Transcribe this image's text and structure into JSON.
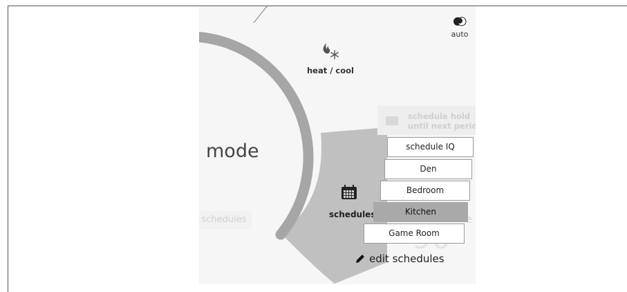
{
  "mode_panel": {
    "title": "mode",
    "ghost_schedules_label": "schedules"
  },
  "modes": {
    "heat_cool": {
      "label": "heat / cool",
      "icon": "flame-snowflake-icon"
    },
    "auto": {
      "label": "auto",
      "icon": "half-moon-icon"
    }
  },
  "schedule_hold": {
    "line1": "schedule hold",
    "line2": "until next period",
    "icon": "calendar-icon"
  },
  "schedules_section": {
    "label": "schedules",
    "icon": "calendar-icon",
    "items": [
      "schedule IQ",
      "Den",
      "Bedroom",
      "Kitchen",
      "Game Room"
    ],
    "selected": "Kitchen",
    "edit_label": "edit schedules",
    "edit_icon": "pencil-icon"
  },
  "background_temp": "90°",
  "colors": {
    "arc": "#a6a6a6",
    "wedge": "#c0c0c0",
    "selected": "#a9a9a9",
    "panel_bg": "#f6f6f6"
  }
}
